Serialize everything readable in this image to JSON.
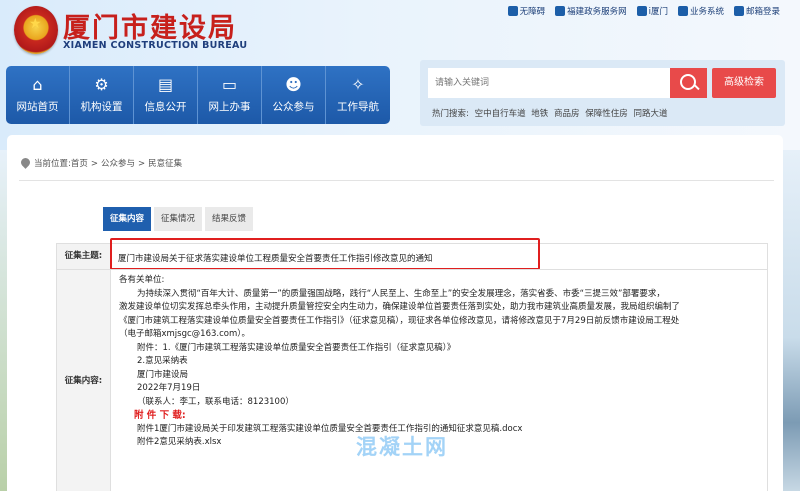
{
  "header": {
    "title": "厦门市建设局",
    "subtitle": "XIAMEN CONSTRUCTION BUREAU",
    "top_links": [
      "无障碍",
      "福建政务服务网",
      "i厦门",
      "业务系统",
      "邮箱登录"
    ]
  },
  "nav": [
    {
      "label": "网站首页",
      "icon": "home-icon",
      "glyph": "⌂"
    },
    {
      "label": "机构设置",
      "icon": "org-chart-icon",
      "glyph": "⚙"
    },
    {
      "label": "信息公开",
      "icon": "document-icon",
      "glyph": "▤"
    },
    {
      "label": "网上办事",
      "icon": "computer-icon",
      "glyph": "▭"
    },
    {
      "label": "公众参与",
      "icon": "people-icon",
      "glyph": "☻"
    },
    {
      "label": "工作导航",
      "icon": "compass-icon",
      "glyph": "✧"
    }
  ],
  "search": {
    "placeholder": "请输入关键词",
    "advanced_label": "高级检索",
    "hot_label": "热门搜索:",
    "hot_terms": [
      "空中自行车道",
      "地铁",
      "商品房",
      "保障性住房",
      "同路大道"
    ]
  },
  "breadcrumb": {
    "prefix": "当前位置:",
    "items": [
      "首页",
      "公众参与",
      "民意征集"
    ]
  },
  "tabs": [
    "征集内容",
    "征集情况",
    "结果反馈"
  ],
  "table": {
    "subject_label": "征集主题:",
    "subject": "厦门市建设局关于征求落实建设单位工程质量安全首要责任工作指引修改意见的通知",
    "content_label": "征集内容:",
    "content": {
      "greeting": "各有关单位:",
      "paragraph_lines": [
        "为持续深入贯彻“百年大计、质量第一”的质量强国战略，践行“人民至上、生命至上”的安全发展理念，落实省委、市委“三提三效”部署要求，",
        "激发建设单位切实发挥总牵头作用，主动提升质量管控安全内生动力，确保建设单位首要责任落到实处，助力我市建筑业高质量发展，我局组织编制了",
        "《厦门市建筑工程落实建设单位质量安全首要责任工作指引》（征求意见稿），现征求各单位修改意见，请将修改意见于7月29日前反馈市建设局工程处",
        "（电子邮箱xmjsgc@163.com）。"
      ],
      "attachments_intro": "附件：1.《厦门市建筑工程落实建设单位质量安全首要责任工作指引（征求意见稿）》",
      "attachment_2": "2.意见采纳表",
      "signature": "厦门市建设局",
      "date": "2022年7月19日",
      "contact": "（联系人：李工，联系电话：8123100）",
      "download_title": "附 件 下 载:",
      "downloads": [
        "附件1厦门市建设局关于印发建筑工程落实建设单位质量安全首要责任工作指引的通知征求意见稿.docx",
        "附件2意见采纳表.xlsx"
      ]
    }
  },
  "watermark": "混凝土网",
  "colors": {
    "brand_blue": "#1f5fae",
    "brand_red": "#c7201c",
    "search_red": "#e84a4a",
    "highlight_red": "#e01f1f"
  }
}
